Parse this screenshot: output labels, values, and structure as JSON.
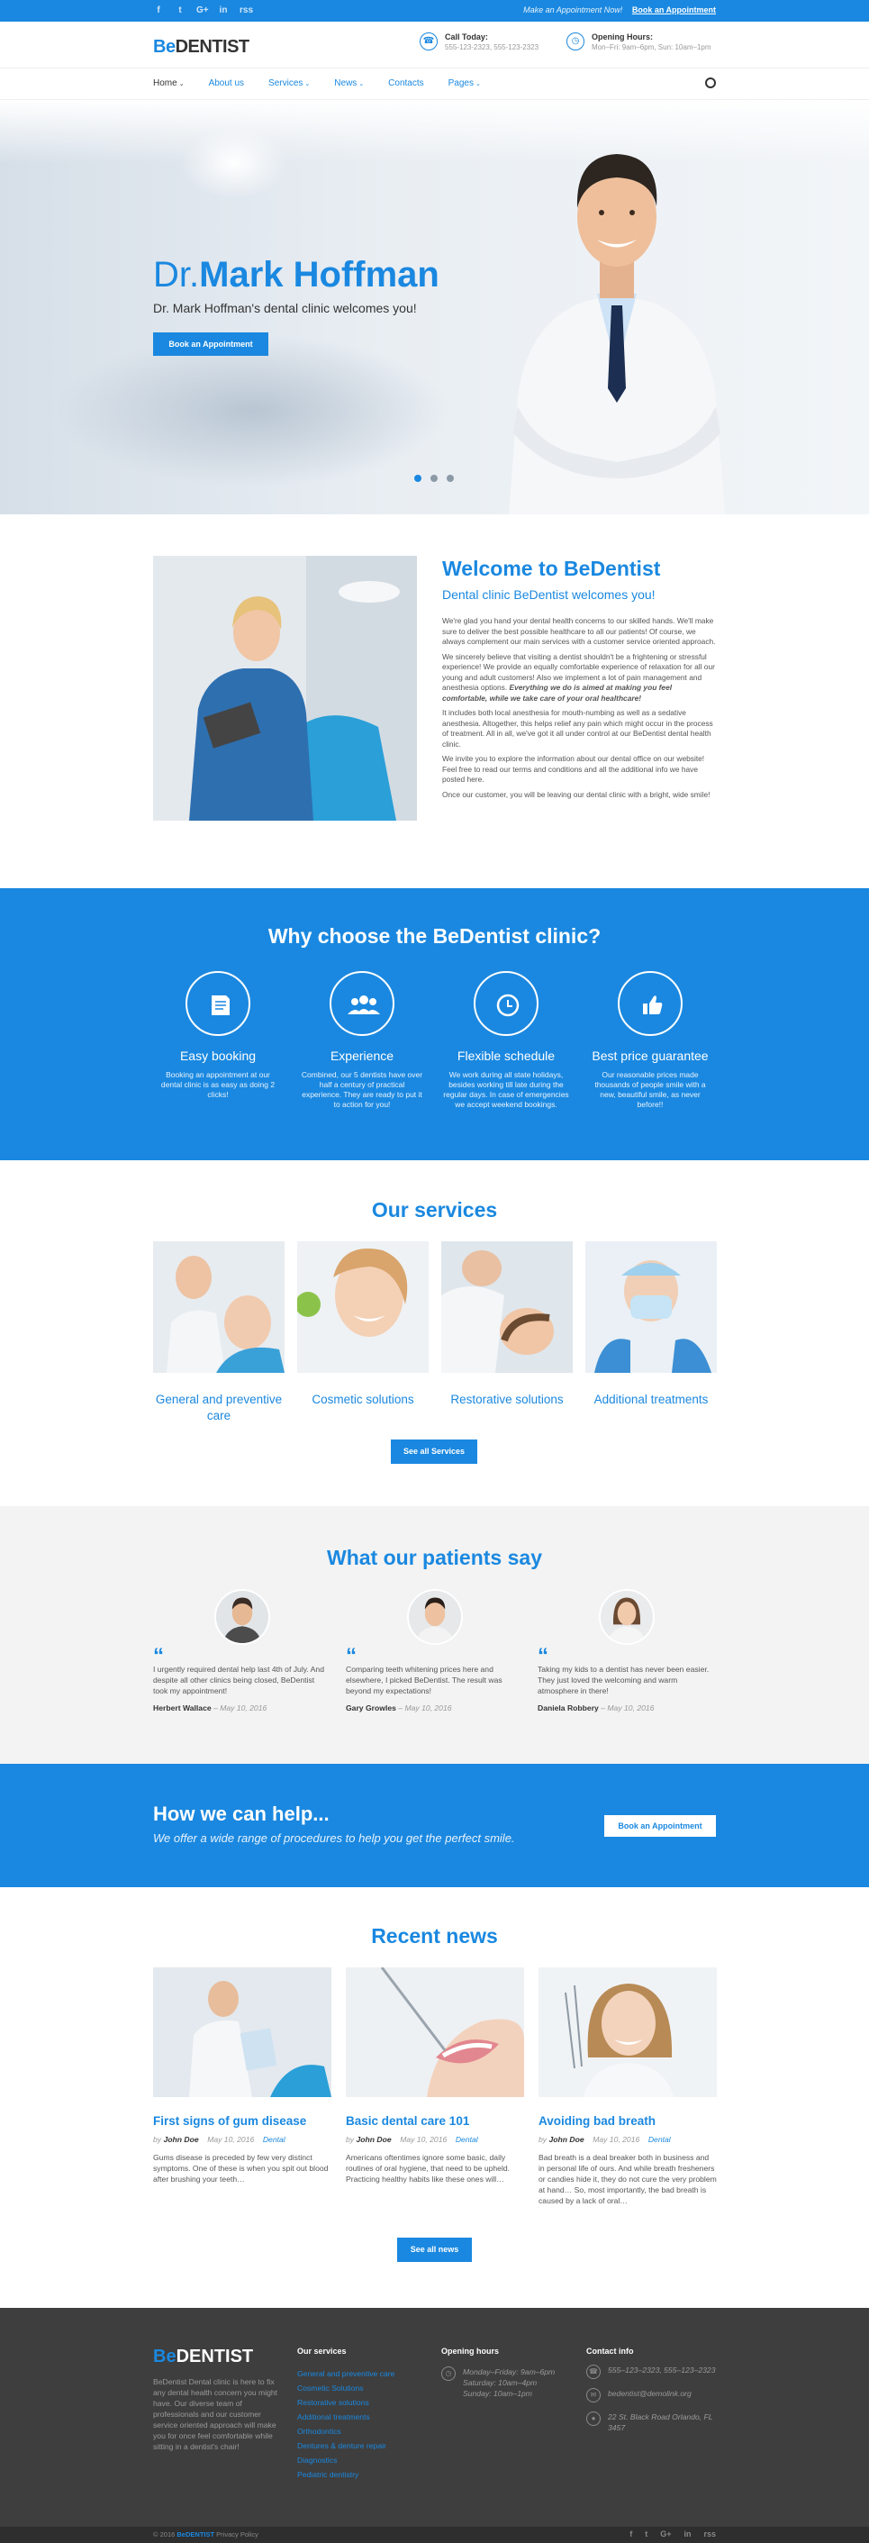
{
  "topbar": {
    "social": [
      "f",
      "t",
      "G+",
      "in",
      "rss"
    ],
    "promo_text": "Make an Appointment Now!",
    "promo_link": "Book an Appointment"
  },
  "header": {
    "logo_be": "Be",
    "logo_rest": "DENTIST",
    "call_title": "Call Today:",
    "call_value": "555-123-2323, 555-123-2323",
    "hours_title": "Opening Hours:",
    "hours_value": "Mon–Fri: 9am–6pm, Sun: 10am–1pm"
  },
  "nav": [
    {
      "label": "Home",
      "chev": "⌄",
      "active": true
    },
    {
      "label": "About us",
      "chev": ""
    },
    {
      "label": "Services",
      "chev": "⌄"
    },
    {
      "label": "News",
      "chev": "⌄"
    },
    {
      "label": "Contacts",
      "chev": ""
    },
    {
      "label": "Pages",
      "chev": "⌄"
    }
  ],
  "hero": {
    "title_prefix": "Dr.",
    "title_name": "Mark Hoffman",
    "subtitle": "Dr. Mark Hoffman's dental clinic welcomes you!",
    "button": "Book an Appointment"
  },
  "welcome": {
    "title": "Welcome to BeDentist",
    "subtitle": "Dental clinic BeDentist welcomes you!",
    "p1": "We're glad you hand your dental health concerns to our skilled hands. We'll make sure to deliver the best possible healthcare to all our patients! Of course, we always complement our main services with a customer service oriented approach.",
    "p2a": "We sincerely believe that visiting a dentist shouldn't be a frightening or stressful experience! We provide an equally comfortable experience of relaxation for all our young and adult customers! Also we implement a lot of pain management and anesthesia options.",
    "p2b": "Everything we do is aimed at making you feel comfortable, while we take care of your oral healthcare!",
    "p3": "It includes both local anesthesia for mouth-numbing as well as a sedative anesthesia. Altogether, this helps relief any pain which might occur in the process of treatment. All in all, we've got it all under control at our BeDentist dental health clinic.",
    "p4": "We invite you to explore the information about our dental office on our website! Feel free to read our terms and conditions and all the additional info we have posted here.",
    "p5": "Once our customer, you will be leaving our dental clinic with a bright, wide smile!"
  },
  "why": {
    "title": "Why choose the BeDentist clinic?",
    "features": [
      {
        "icon": "book-icon",
        "title": "Easy booking",
        "text": "Booking an appointment at our dental clinic is as easy as doing 2 clicks!"
      },
      {
        "icon": "people-icon",
        "title": "Experience",
        "text": "Combined, our 5 dentists have over half a century of practical experience. They are ready to put it to action for you!"
      },
      {
        "icon": "clock-icon",
        "title": "Flexible schedule",
        "text": "We work during all state holidays, besides working till late during the regular days. In case of emergencies we accept weekend bookings."
      },
      {
        "icon": "thumbs-up-icon",
        "title": "Best price guarantee",
        "text": "Our reasonable prices made thousands of people smile with a new, beautiful smile, as never before!!"
      }
    ]
  },
  "services": {
    "title": "Our services",
    "items": [
      {
        "label": "General and preventive care"
      },
      {
        "label": "Cosmetic solutions"
      },
      {
        "label": "Restorative solutions"
      },
      {
        "label": "Additional treatments"
      }
    ],
    "button": "See all Services"
  },
  "testimonials": {
    "title": "What our patients say",
    "quote_mark": "“",
    "items": [
      {
        "text": "I urgently required dental help last 4th of July. And despite all other clinics being closed, BeDentist took my appointment!",
        "name": "Herbert Wallace",
        "date": "– May 10, 2016"
      },
      {
        "text": "Comparing teeth whitening prices here and elsewhere, I picked BeDentist. The result was beyond my expectations!",
        "name": "Gary Growles",
        "date": "– May 10, 2016"
      },
      {
        "text": "Taking my kids to a dentist has never been easier. They just loved the welcoming and warm atmosphere in there!",
        "name": "Daniela Robbery",
        "date": "– May 10, 2016"
      }
    ]
  },
  "help": {
    "title": "How we can help...",
    "subtitle": "We offer a wide range of procedures to help you get the perfect smile.",
    "button": "Book an Appointment"
  },
  "news": {
    "title": "Recent news",
    "by": "by",
    "items": [
      {
        "title": "First signs of gum disease",
        "author": "John Doe",
        "date": "May 10, 2016",
        "category": "Dental",
        "text": "Gums disease is preceded by few very distinct symptoms. One of these is when you spit out blood after brushing your teeth…"
      },
      {
        "title": "Basic dental care 101",
        "author": "John Doe",
        "date": "May 10, 2016",
        "category": "Dental",
        "text": "Americans oftentimes ignore some basic, daily routines of oral hygiene, that need to be upheld. Practicing healthy habits like these ones will…"
      },
      {
        "title": "Avoiding bad breath",
        "author": "John Doe",
        "date": "May 10, 2016",
        "category": "Dental",
        "text": "Bad breath is a deal breaker both in business and in personal life of ours. And while breath fresheners or candies hide it, they do not cure the very problem at hand… So, most importantly, the bad breath is caused by a lack of oral…"
      }
    ],
    "button": "See all news"
  },
  "footer": {
    "about": "BeDentist Dental clinic is here to fix any dental health concern you might have. Our diverse team of professionals and our customer service oriented approach will make you for once feel comfortable while sitting in a dentist's chair!",
    "services_title": "Our services",
    "services": [
      "General and preventive care",
      "Cosmetic Solutions",
      "Restorative solutions",
      "Additional treatments",
      "Orthodontics",
      "Dentures & denture repair",
      "Diagnostics",
      "Pediatric dentistry"
    ],
    "hours_title": "Opening hours",
    "hours": [
      "Monday–Friday: 9am–6pm",
      "Saturday: 10am–4pm",
      "Sunday: 10am–1pm"
    ],
    "contact_title": "Contact info",
    "phone": "555–123–2323, 555–123–2323",
    "email": "bedentist@demolink.org",
    "address": "22 St. Black Road Orlando, FL 3457"
  },
  "bottom": {
    "copy_prefix": "© 2016",
    "brand": "BeDENTIST",
    "privacy": "Privacy Policy",
    "social": [
      "f",
      "t",
      "G+",
      "in",
      "rss"
    ]
  }
}
